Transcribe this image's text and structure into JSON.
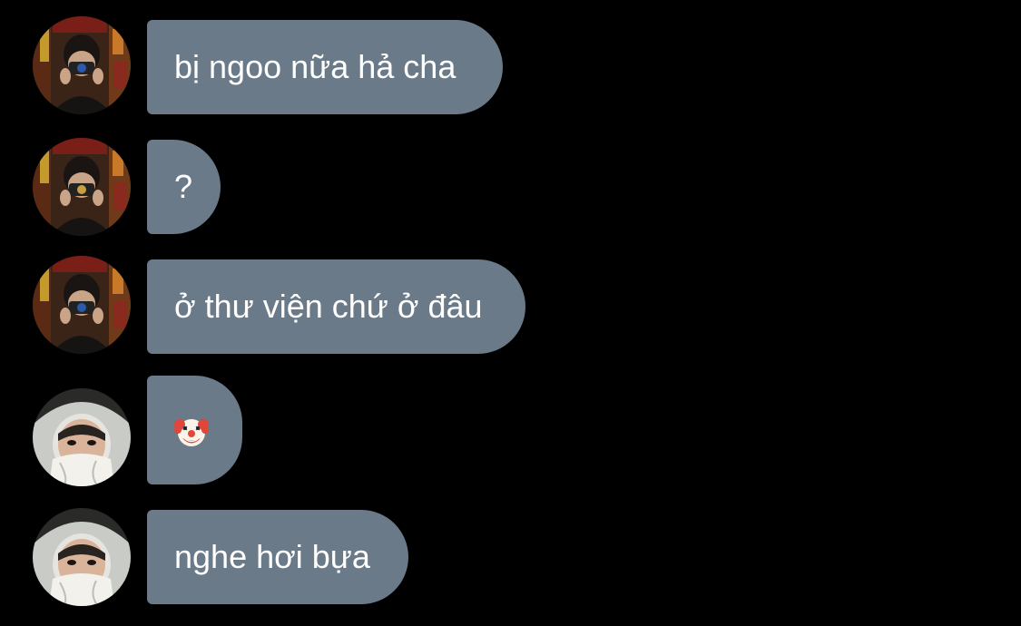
{
  "messages": [
    {
      "sender": "friend_a",
      "text": "bị ngoo nữa hả cha"
    },
    {
      "sender": "friend_a",
      "text": "?"
    },
    {
      "sender": "friend_a",
      "text": "ở thư viện chứ ở đâu"
    },
    {
      "sender": "friend_b",
      "emoji": "clown-face"
    },
    {
      "sender": "friend_b",
      "text": "nghe hơi bựa"
    }
  ],
  "colors": {
    "background": "#000000",
    "bubble": "#6a7a88",
    "text": "#ffffff"
  }
}
